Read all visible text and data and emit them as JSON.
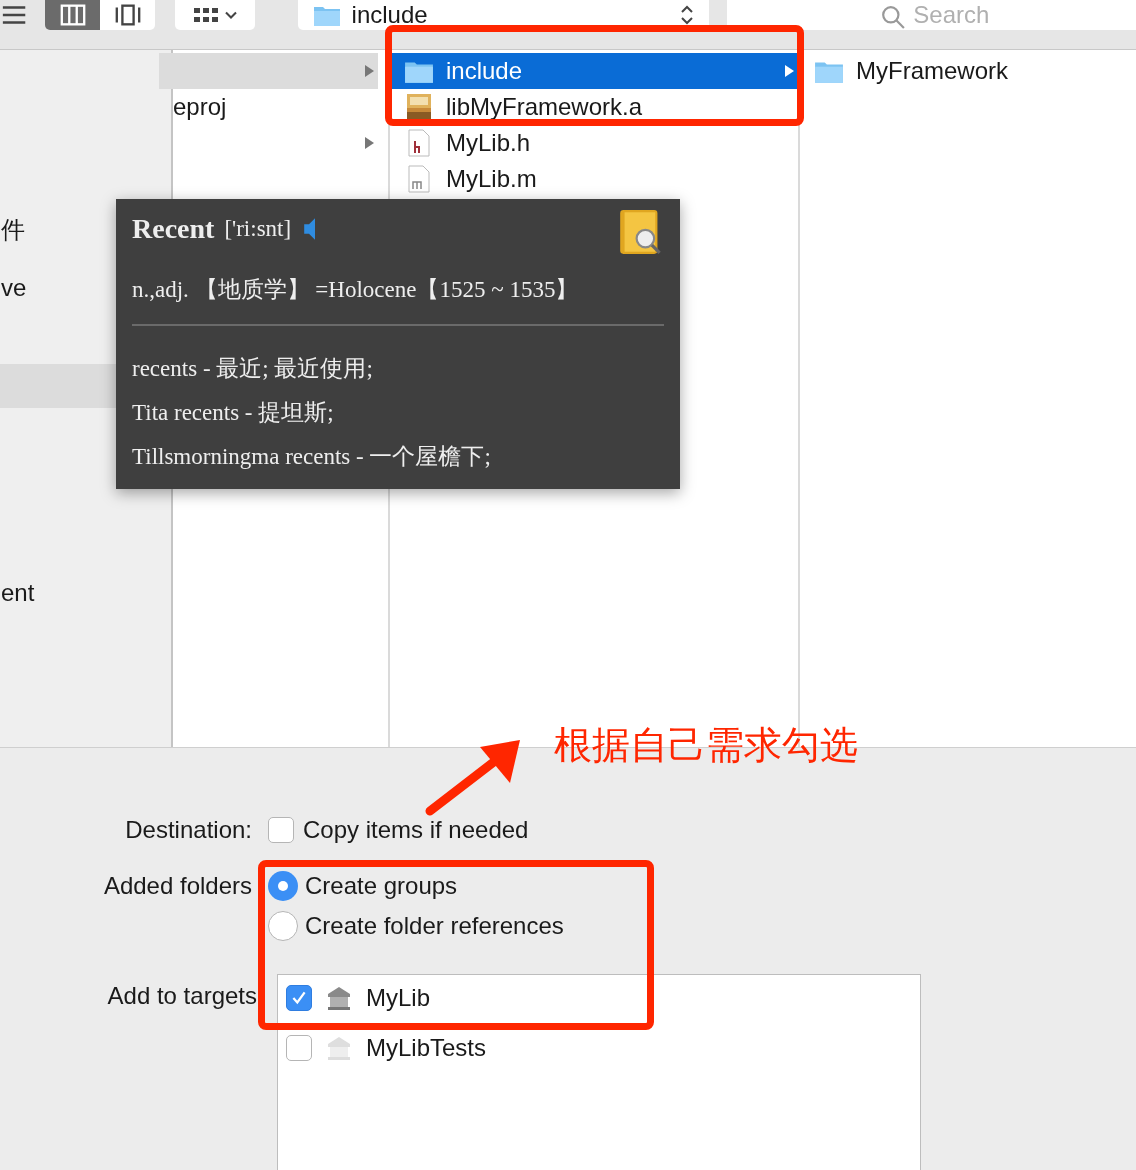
{
  "toolbar": {
    "view_buttons": [
      {
        "kind": "list",
        "selected": false
      },
      {
        "kind": "columns",
        "selected": true
      },
      {
        "kind": "cover_flow",
        "selected": false
      }
    ],
    "path_popup": "include",
    "search": {
      "placeholder": "Search"
    }
  },
  "sidebar": {
    "items": [
      {
        "label": "件",
        "selected": false
      },
      {
        "label": "ve",
        "selected": false
      },
      {
        "selected": true
      },
      {
        "label": "ent",
        "selected": false
      }
    ]
  },
  "columns": [
    {
      "rows": [
        {
          "selected": true,
          "has_children": true
        },
        {
          "label": "eproj",
          "selected": false,
          "has_children": false
        },
        {
          "selected": false,
          "has_children": true
        }
      ]
    },
    {
      "rows": [
        {
          "label": "include",
          "kind": "folder",
          "selected": true,
          "has_children": true
        },
        {
          "label": "libMyFramework.a",
          "kind": "archive",
          "selected": false,
          "has_children": false
        },
        {
          "label": "MyLib.h",
          "kind": "header",
          "selected": false,
          "has_children": false
        },
        {
          "label": "MyLib.m",
          "kind": "source",
          "selected": false,
          "has_children": false
        }
      ]
    },
    {
      "rows": [
        {
          "label": "MyFramework",
          "kind": "folder",
          "selected": false,
          "has_children": false
        }
      ]
    }
  ],
  "dictionary_popup": {
    "headword": "Recent",
    "phonetic": "['ri:snt]",
    "definition": "n.,adj. 【地质学】 =Holocene【1525 ~ 1535】",
    "entries": [
      "recents - 最近; 最近使用;",
      "Tita recents - 提坦斯;",
      "Tillsmorningma recents - 一个屋檐下;"
    ]
  },
  "options": {
    "destination": {
      "label": "Destination:",
      "option": "Copy items if needed",
      "checked": false
    },
    "added_folders": {
      "label": "Added folders",
      "choices": [
        {
          "label": "Create groups",
          "selected": true
        },
        {
          "label": "Create folder references",
          "selected": false
        }
      ]
    },
    "targets": {
      "label": "Add to targets",
      "items": [
        {
          "label": "MyLib",
          "checked": true
        },
        {
          "label": "MyLibTests",
          "checked": false
        }
      ]
    }
  },
  "annotation": {
    "note": "根据自己需求勾选"
  }
}
